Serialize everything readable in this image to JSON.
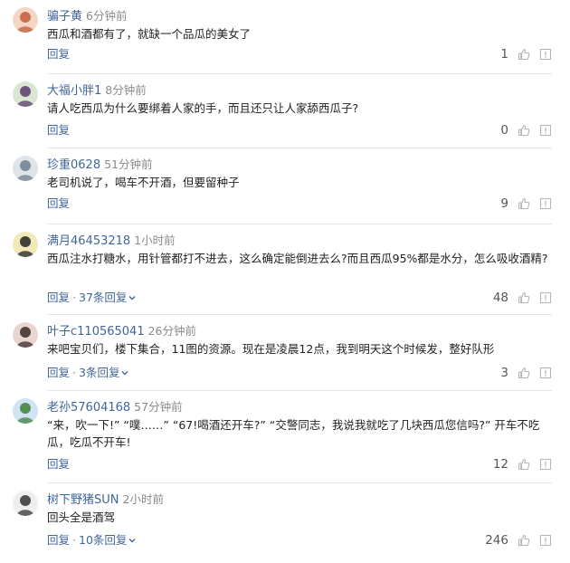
{
  "comments": [
    {
      "user": "骗子黄",
      "time": "6分钟前",
      "text": "西瓜和酒都有了，就缺一个品瓜的美女了",
      "reply_label": "回复",
      "replies_label": "",
      "likes": "1",
      "avatar": {
        "bg": "#f3d7c5",
        "fg": "#c65a3a",
        "icon": "avatar-icon"
      }
    },
    {
      "user": "大福小胖1",
      "time": "8分钟前",
      "text": "请人吃西瓜为什么要绑着人家的手，而且还只让人家舔西瓜子?",
      "reply_label": "回复",
      "replies_label": "",
      "likes": "0",
      "avatar": {
        "bg": "#d9e6d2",
        "fg": "#5c3a6b",
        "icon": "avatar-icon"
      }
    },
    {
      "user": "珍重0628",
      "time": "51分钟前",
      "text": "老司机说了，喝车不开酒，但要留种子",
      "reply_label": "回复",
      "replies_label": "",
      "likes": "9",
      "avatar": {
        "bg": "#dfe4ea",
        "fg": "#6f7f90",
        "icon": "avatar-icon"
      }
    },
    {
      "user": "满月46453218",
      "time": "1小时前",
      "text": "西瓜注水打糖水，用针管都打不进去，这么确定能倒进去么?而且西瓜95%都是水分，怎么吸收酒精?",
      "reply_label": "回复",
      "replies_label": "37条回复",
      "likes": "48",
      "avatar": {
        "bg": "#f2e8b8",
        "fg": "#222222",
        "icon": "avatar-icon"
      }
    },
    {
      "user": "叶子c110565041",
      "time": "26分钟前",
      "text": "来吧宝贝们，楼下集合，11图的资源。现在是凌晨12点，我到明天这个时候发，整好队形",
      "reply_label": "回复",
      "replies_label": "3条回复",
      "likes": "3",
      "avatar": {
        "bg": "#e9d6cf",
        "fg": "#3a2a26",
        "icon": "avatar-icon"
      }
    },
    {
      "user": "老孙57604168",
      "time": "57分钟前",
      "text": "“来，吹一下!” “噗……” “67!喝酒还开车?” “交警同志，我说我就吃了几块西瓜您信吗?” 开车不吃瓜，吃瓜不开车!",
      "reply_label": "回复",
      "replies_label": "",
      "likes": "12",
      "avatar": {
        "bg": "#cfe3f2",
        "fg": "#3f7f3a",
        "icon": "avatar-icon"
      }
    },
    {
      "user": "树下野猪SUN",
      "time": "2小时前",
      "text": "回头全是酒驾",
      "reply_label": "回复",
      "replies_label": "10条回复",
      "likes": "246",
      "avatar": {
        "bg": "#eeeeee",
        "fg": "#333333",
        "icon": "avatar-icon"
      }
    }
  ],
  "colors": {
    "link": "#406599",
    "meta": "#8a8a8a",
    "icon": "#b5b5b5",
    "divider": "#e6e6e6"
  }
}
